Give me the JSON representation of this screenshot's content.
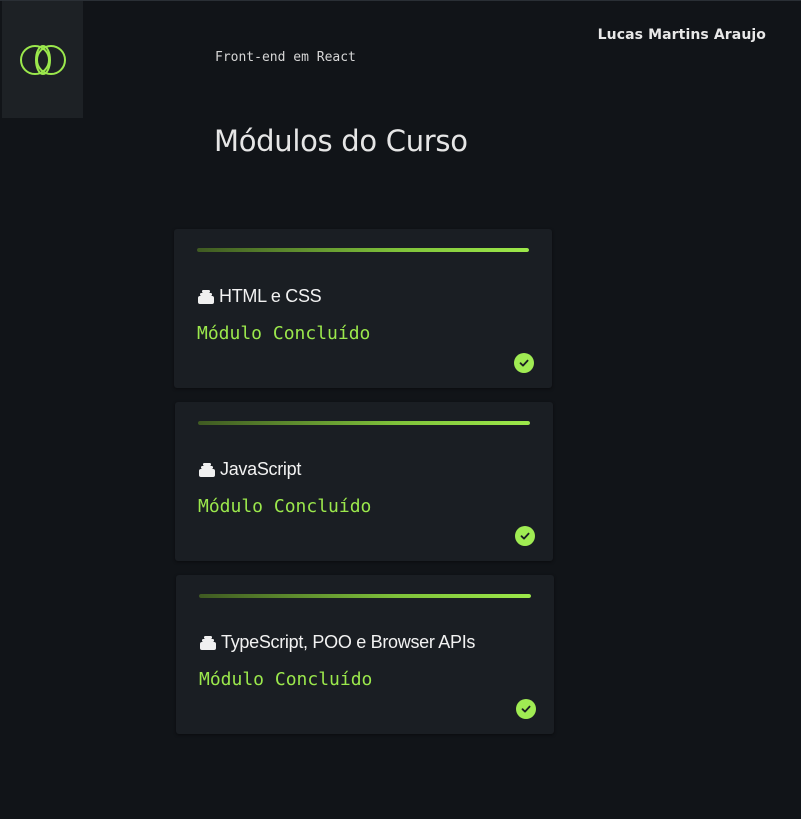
{
  "header": {
    "course_name": "Front-end em React",
    "user_name": "Lucas Martins Araujo",
    "logo_icon": "overlapping-rings-logo-icon"
  },
  "main": {
    "title": "Módulos do Curso"
  },
  "modules": [
    {
      "title": "HTML e CSS",
      "status": "Módulo Concluído",
      "progress": 1.0,
      "icon": "stack-icon",
      "status_icon": "check-circle-icon"
    },
    {
      "title": "JavaScript",
      "status": "Módulo Concluído",
      "progress": 1.0,
      "icon": "stack-icon",
      "status_icon": "check-circle-icon"
    },
    {
      "title": "TypeScript, POO e Browser APIs",
      "status": "Módulo Concluído",
      "progress": 1.0,
      "icon": "stack-icon",
      "status_icon": "check-circle-icon"
    }
  ],
  "colors": {
    "background": "#111418",
    "card": "#1a1e23",
    "accent": "#9be84c",
    "text": "#e6e6e6"
  }
}
